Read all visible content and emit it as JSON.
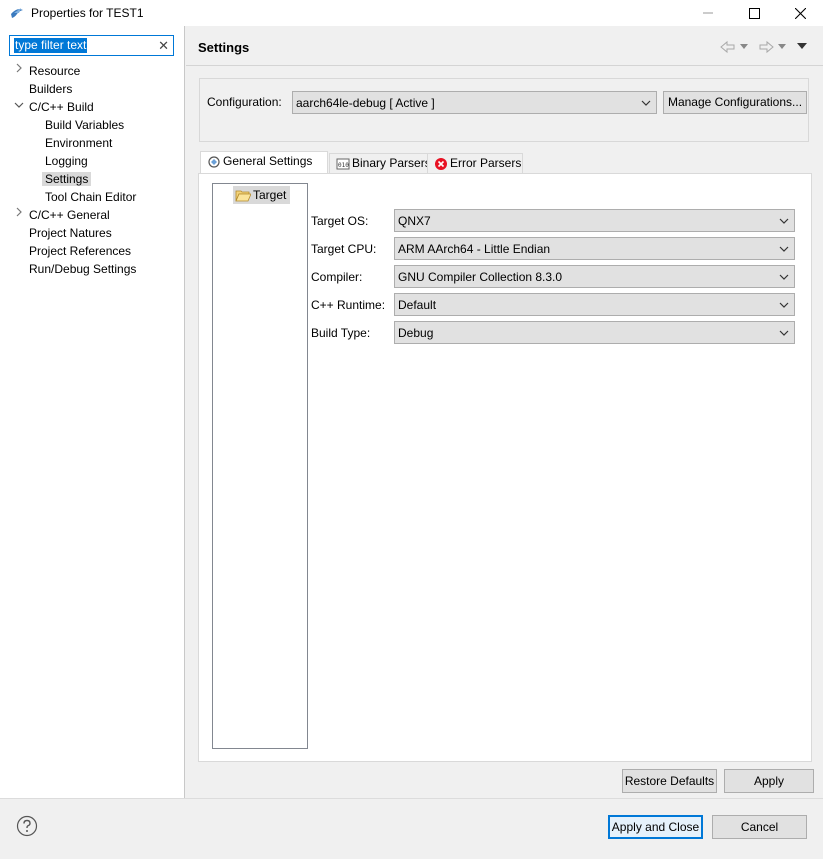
{
  "window": {
    "title": "Properties for TEST1"
  },
  "filter": {
    "placeholder": "type filter text",
    "value": "type filter text"
  },
  "tree": {
    "items": [
      {
        "label": "Resource",
        "expandable": true,
        "expanded": false
      },
      {
        "label": "Builders"
      },
      {
        "label": "C/C++ Build",
        "expandable": true,
        "expanded": true
      },
      {
        "label": "Build Variables"
      },
      {
        "label": "Environment"
      },
      {
        "label": "Logging"
      },
      {
        "label": "Settings",
        "selected": true
      },
      {
        "label": "Tool Chain Editor"
      },
      {
        "label": "C/C++ General",
        "expandable": true,
        "expanded": false
      },
      {
        "label": "Project Natures"
      },
      {
        "label": "Project References"
      },
      {
        "label": "Run/Debug Settings"
      }
    ]
  },
  "page": {
    "title": "Settings"
  },
  "configuration": {
    "label": "Configuration:",
    "value": "aarch64le-debug  [ Active ]",
    "manage_button": "Manage Configurations..."
  },
  "tabs": [
    {
      "label": "General Settings",
      "active": true
    },
    {
      "label": "Binary Parsers"
    },
    {
      "label": "Error Parsers"
    }
  ],
  "target_tree": {
    "node": "Target"
  },
  "properties": [
    {
      "label": "Target OS:",
      "value": "QNX7"
    },
    {
      "label": "Target CPU:",
      "value": "ARM AArch64 - Little Endian"
    },
    {
      "label": "Compiler:",
      "value": "GNU Compiler Collection 8.3.0"
    },
    {
      "label": "C++ Runtime:",
      "value": "Default"
    },
    {
      "label": "Build Type:",
      "value": "Debug"
    }
  ],
  "buttons": {
    "restore_defaults": "Restore Defaults",
    "apply": "Apply",
    "apply_and_close": "Apply and Close",
    "cancel": "Cancel"
  },
  "colors": {
    "accent": "#0078d7",
    "error": "#e81123"
  }
}
